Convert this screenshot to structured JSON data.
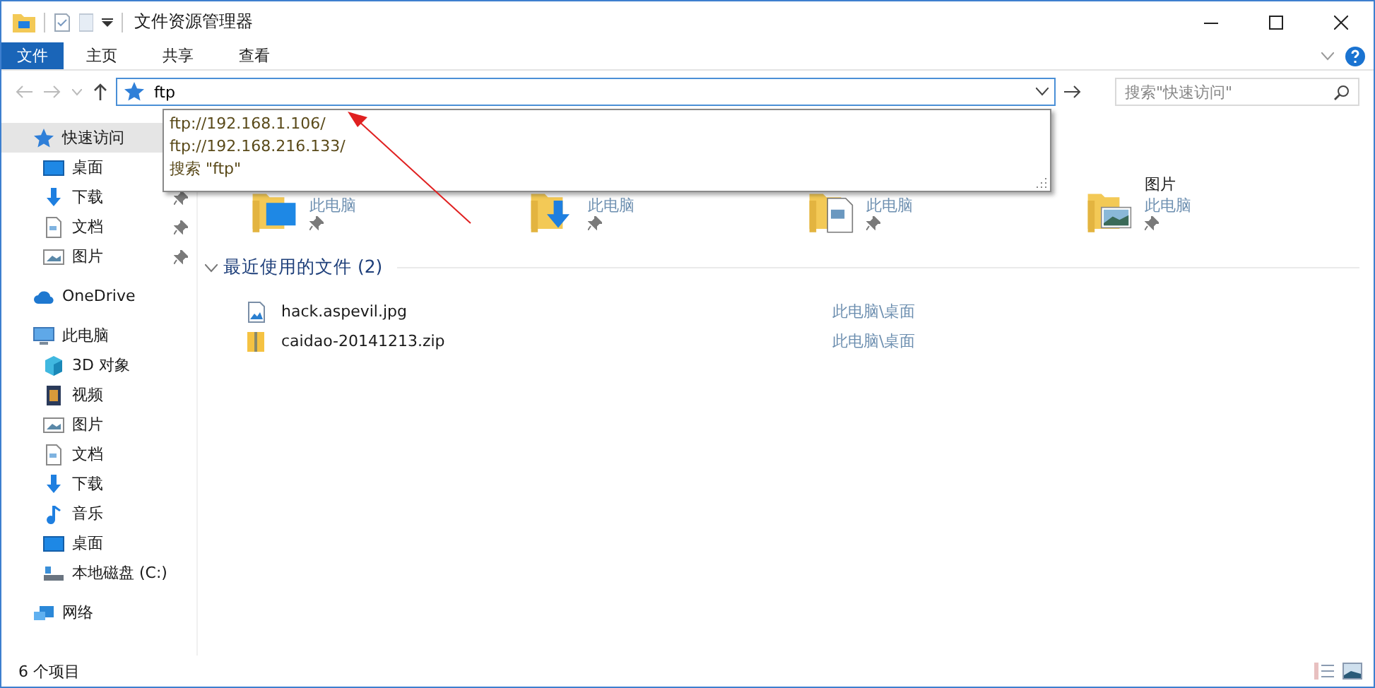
{
  "window": {
    "title": "文件资源管理器"
  },
  "ribbon_tabs": [
    {
      "label": "文件",
      "selected": true
    },
    {
      "label": "主页",
      "selected": false
    },
    {
      "label": "共享",
      "selected": false
    },
    {
      "label": "查看",
      "selected": false
    }
  ],
  "address_bar": {
    "value": "ftp",
    "suggestions": [
      "ftp://192.168.1.106/",
      "ftp://192.168.216.133/",
      "搜索 \"ftp\""
    ]
  },
  "search": {
    "placeholder": "搜索\"快速访问\""
  },
  "navigation": [
    {
      "kind": "star",
      "label": "快速访问",
      "selected": true,
      "children": [
        {
          "kind": "desktop",
          "label": "桌面",
          "selected": false,
          "pinned": false
        },
        {
          "kind": "download",
          "label": "下载",
          "selected": false,
          "pinned": true
        },
        {
          "kind": "document",
          "label": "文档",
          "selected": false,
          "pinned": true
        },
        {
          "kind": "picture",
          "label": "图片",
          "selected": false,
          "pinned": true
        }
      ]
    },
    {
      "kind": "cloud",
      "label": "OneDrive",
      "selected": false
    },
    {
      "kind": "computer",
      "label": "此电脑",
      "selected": false,
      "children": [
        {
          "kind": "cube",
          "label": "3D 对象",
          "selected": false
        },
        {
          "kind": "video",
          "label": "视频",
          "selected": false
        },
        {
          "kind": "picture",
          "label": "图片",
          "selected": false
        },
        {
          "kind": "document",
          "label": "文档",
          "selected": false
        },
        {
          "kind": "download",
          "label": "下载",
          "selected": false
        },
        {
          "kind": "music",
          "label": "音乐",
          "selected": false
        },
        {
          "kind": "desktop",
          "label": "桌面",
          "selected": false
        },
        {
          "kind": "drive",
          "label": "本地磁盘 (C:)",
          "selected": false
        }
      ]
    },
    {
      "kind": "network",
      "label": "网络",
      "selected": false
    }
  ],
  "folders": [
    {
      "kind": "desktop",
      "location": "此电脑",
      "pinned": true
    },
    {
      "kind": "download",
      "location": "此电脑",
      "pinned": true
    },
    {
      "kind": "document",
      "location": "此电脑",
      "pinned": true
    },
    {
      "kind": "picture",
      "name": "图片",
      "location": "此电脑",
      "pinned": true
    }
  ],
  "recent": {
    "title": "最近使用的文件 (2)",
    "expanded": true,
    "files": [
      {
        "kind": "image",
        "name": "hack.aspevil.jpg",
        "path": "此电脑\\桌面"
      },
      {
        "kind": "zip",
        "name": "caidao-20141213.zip",
        "path": "此电脑\\桌面"
      }
    ]
  },
  "status_bar": {
    "item_count": "6 个项目"
  }
}
